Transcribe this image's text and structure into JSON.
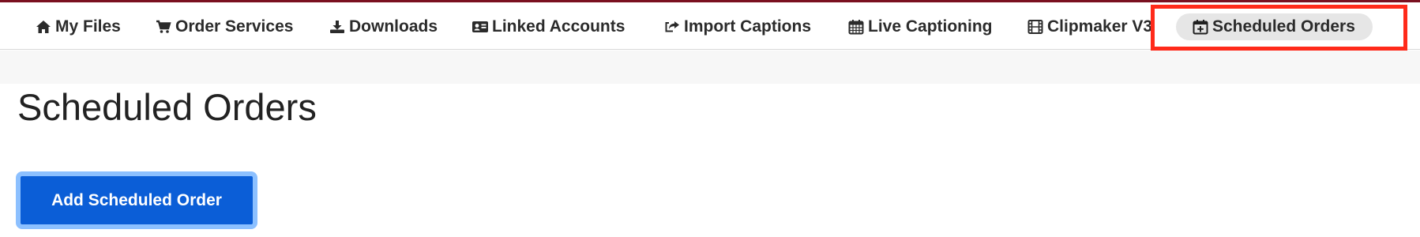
{
  "nav": {
    "items": [
      {
        "label": "My Files",
        "icon": "home-icon"
      },
      {
        "label": "Order Services",
        "icon": "cart-icon"
      },
      {
        "label": "Downloads",
        "icon": "download-icon"
      },
      {
        "label": "Linked Accounts",
        "icon": "id-card-icon"
      },
      {
        "label": "Import Captions",
        "icon": "share-icon"
      },
      {
        "label": "Live Captioning",
        "icon": "calendar-icon"
      },
      {
        "label": "Clipmaker V3",
        "icon": "film-icon"
      },
      {
        "label": "Scheduled Orders",
        "icon": "calendar-plus-icon",
        "active": true
      }
    ]
  },
  "page": {
    "title": "Scheduled Orders",
    "add_button_label": "Add Scheduled Order"
  },
  "colors": {
    "top_line": "#7a1020",
    "primary_button": "#0b5ed7",
    "button_focus_ring": "#8cc0ff",
    "highlight_box": "#ff2a1a",
    "active_nav_bg": "#e6e6e6"
  }
}
